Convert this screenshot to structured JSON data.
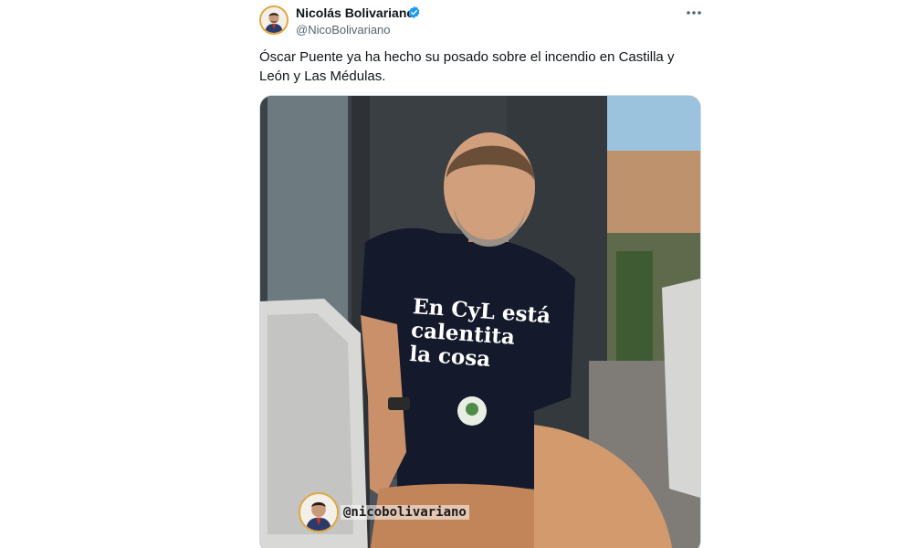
{
  "author": {
    "display_name": "Nicolás Bolivariano",
    "handle": "@NicoBolivariano",
    "verified": true,
    "avatar_icon": "profile-avatar-icon",
    "accent_color": "#e2a53b"
  },
  "tweet": {
    "text": "Óscar Puente ya ha hecho su posado sobre el incendio en Castilla y León y Las Médulas.",
    "more_icon": "more-options-icon"
  },
  "media": {
    "shirt_lines": [
      "En CyL está",
      "calentita",
      "la cosa"
    ],
    "watermark_handle": "@nicobolivariano"
  },
  "colors": {
    "text_primary": "#0f1419",
    "text_secondary": "#536471",
    "verified_blue": "#1d9bf0",
    "border": "#cfd9de"
  }
}
